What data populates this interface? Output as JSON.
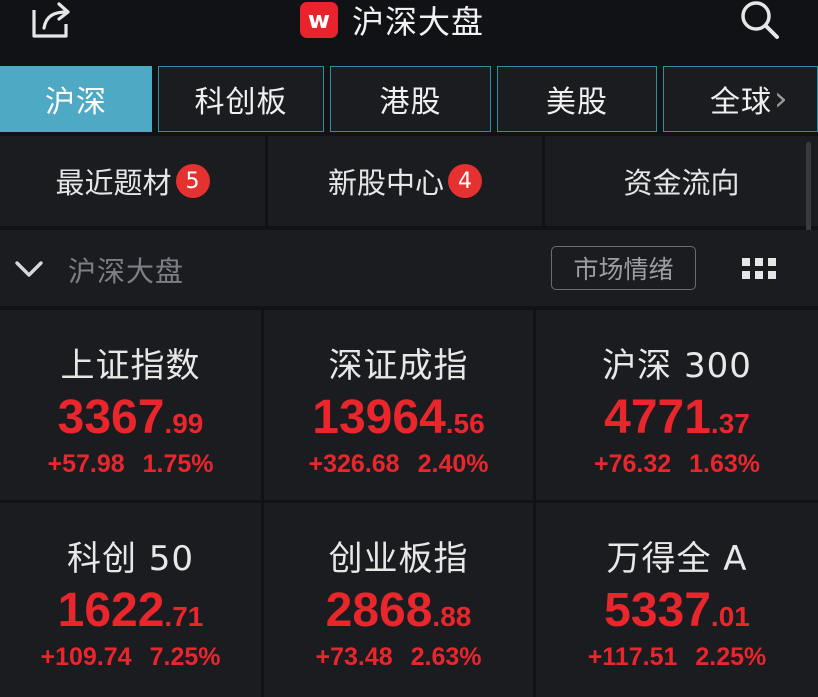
{
  "header": {
    "title": "沪深大盘",
    "logo_text": "w",
    "icons": {
      "share": "share-icon",
      "search": "search-icon"
    },
    "brand_color": "#e8232c"
  },
  "tabs": [
    {
      "label": "沪深",
      "active": true
    },
    {
      "label": "科创板",
      "active": false
    },
    {
      "label": "港股",
      "active": false
    },
    {
      "label": "美股",
      "active": false
    },
    {
      "label": "全球",
      "active": false
    }
  ],
  "tab_more_icon": "chevron-right-icon",
  "shortcuts": [
    {
      "label": "最近题材",
      "badge": "5"
    },
    {
      "label": "新股中心",
      "badge": "4"
    },
    {
      "label": "资金流向",
      "badge": ""
    }
  ],
  "section": {
    "title": "沪深大盘",
    "sentiment_label": "市场情绪",
    "icons": {
      "collapse": "chevron-down-icon",
      "layout": "grid-icon"
    }
  },
  "indices": [
    {
      "name": "上证指数",
      "price_int": "3367",
      "price_dec": ".99",
      "change": "+57.98",
      "pct": "1.75%"
    },
    {
      "name": "深证成指",
      "price_int": "13964",
      "price_dec": ".56",
      "change": "+326.68",
      "pct": "2.40%"
    },
    {
      "name": "沪深 300",
      "price_int": "4771",
      "price_dec": ".37",
      "change": "+76.32",
      "pct": "1.63%"
    },
    {
      "name": "科创 50",
      "price_int": "1622",
      "price_dec": ".71",
      "change": "+109.74",
      "pct": "7.25%"
    },
    {
      "name": "创业板指",
      "price_int": "2868",
      "price_dec": ".88",
      "change": "+73.48",
      "pct": "2.63%"
    },
    {
      "name": "万得全 A",
      "price_int": "5337",
      "price_dec": ".01",
      "change": "+117.51",
      "pct": "2.25%"
    }
  ],
  "colors": {
    "up": "#e8262c",
    "tab_active": "#4ea9c4",
    "background": "#111215",
    "panel": "#1b1c20"
  }
}
